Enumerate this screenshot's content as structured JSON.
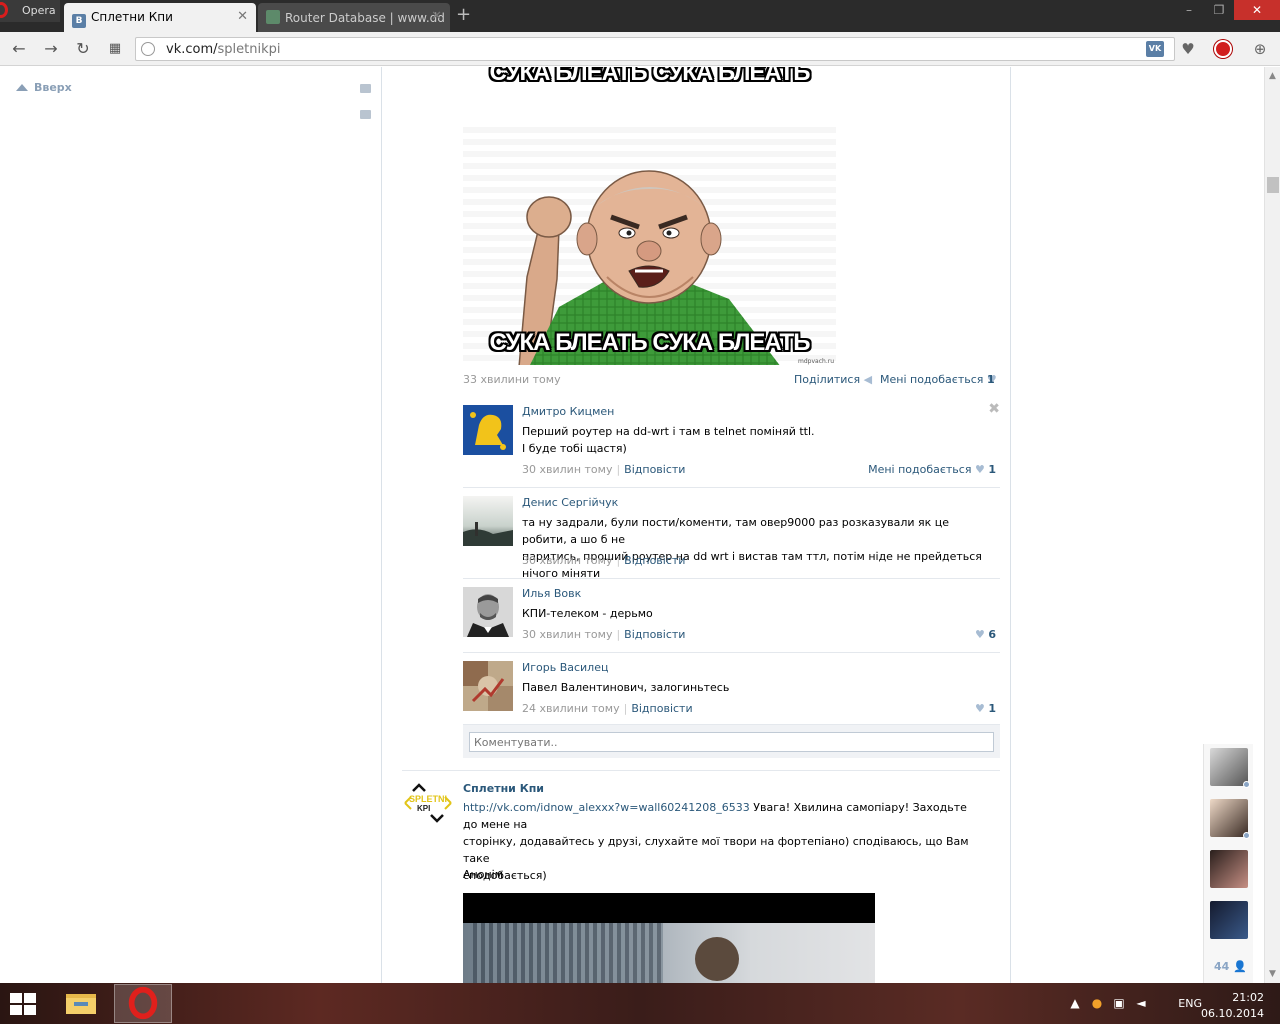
{
  "browser": {
    "menu_label": "Opera",
    "tabs": [
      {
        "label": "Сплетни Кпи",
        "favicon": "vk-icon",
        "active": true
      },
      {
        "label": "Router Database | www.dd",
        "favicon": "ddwrt-icon",
        "active": false
      }
    ],
    "new_tab": "+",
    "address": {
      "host": "vk.com/",
      "path": "spletnikpi"
    },
    "vk_badge": "VK"
  },
  "sidebar": {
    "up_label": "Вверх"
  },
  "post1": {
    "meme_top": "СУКА БЛЕАТЬ СУКА БЛЕАТЬ",
    "meme_bottom": "СУКА БЛЕАТЬ СУКА БЛЕАТЬ",
    "meme_watermark": "mdpvach.ru",
    "time": "33 хвилини тому",
    "share_label": "Поділитися",
    "like_label": "Мені подобається",
    "like_count": "1"
  },
  "replies": [
    {
      "name": "Дмитро Кицмен",
      "text_lines": [
        "Перший роутер на dd-wrt і там в telnet поміняй ttl.",
        "І буде тобі щастя)"
      ],
      "time": "30 хвилин тому",
      "reply_label": "Відповісти",
      "like_label": "Мені подобається",
      "likes": "1"
    },
    {
      "name": "Денис Сергійчук",
      "text_lines": [
        "та ну задрали, були пости/коменти, там овер9000 раз розказували як це робити, а шо б не",
        "паритись, проший роутер на dd wrt і вистав там ттл, потім ніде не прейдеться нічого міняти"
      ],
      "time": "30 хвилин тому",
      "reply_label": "Відповісти",
      "likes": ""
    },
    {
      "name": "Илья Вовк",
      "text_lines": [
        "КПИ-телеком - дерьмо"
      ],
      "time": "30 хвилин тому",
      "reply_label": "Відповісти",
      "likes": "6"
    },
    {
      "name": "Игорь Василец",
      "text_lines": [
        "Павел Валентинович, залогиньтесь"
      ],
      "time": "24 хвилини тому",
      "reply_label": "Відповісти",
      "likes": "1"
    }
  ],
  "comment_placeholder": "Коментувати..",
  "post2": {
    "author": "Сплетни Кпи",
    "logo_text": "SPLETNI KPI",
    "link": "http://vk.com/idnow_alexxx?w=wall60241208_6533",
    "text_after_link": " Увага! Хвилина самопіару! Заходьте до мене на",
    "text_line2": "сторінку, додавайтесь у друзі, слухайте мої твори на фортепіано) сподіваюсь, що Вам таке",
    "text_line3": "сподобається)",
    "anon": "Анонім"
  },
  "friends": {
    "count": "44"
  },
  "taskbar": {
    "lang": "ENG",
    "time": "21:02",
    "date": "06.10.2014"
  },
  "colors": {
    "vk_link": "#2b587a",
    "opera_red": "#d81d1d",
    "close_red": "#c7302b"
  }
}
